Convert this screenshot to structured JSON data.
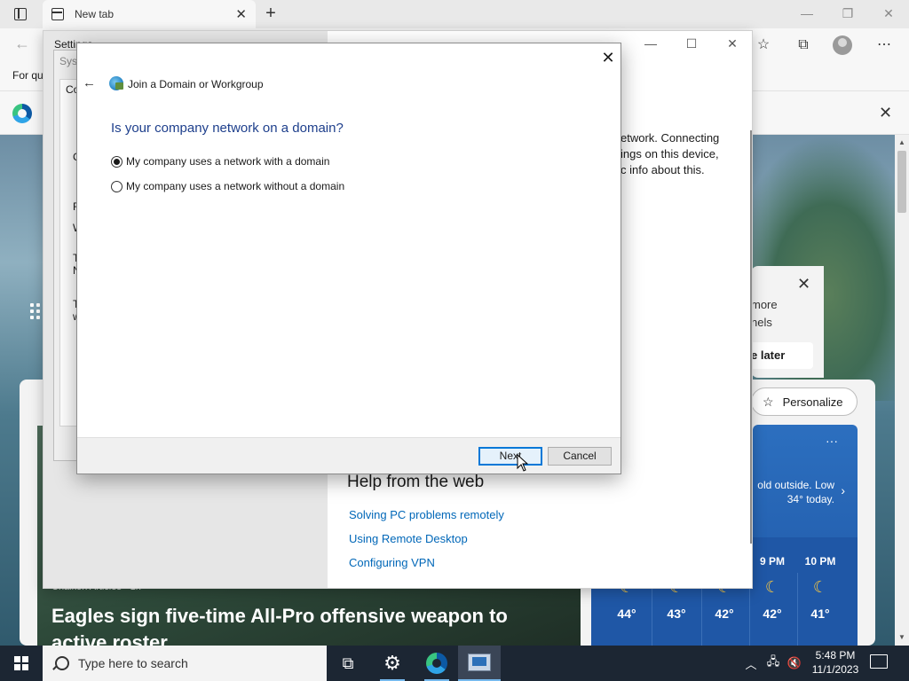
{
  "browser": {
    "tab_label": "New tab",
    "tab_close": "✕",
    "new_tab": "+",
    "favorites_bar_text": "For qu",
    "window_controls": {
      "minimize": "—",
      "restore": "❐",
      "close": "✕"
    }
  },
  "ntp": {
    "personalize_label": "Personalize",
    "popup_text_line1": "more",
    "popup_text_line2": "nels",
    "popup_button": "e later",
    "popup_close": "✕",
    "news_source": "Chalkoh Articles · 1h",
    "news_headline": "Eagles sign five-time All-Pro offensive weapon to active roster",
    "weather_more": "···",
    "weather_desc": "old outside. Low 34° today.",
    "forecast": [
      {
        "time": "",
        "temp": "44°"
      },
      {
        "time": "",
        "temp": "43°"
      },
      {
        "time": "",
        "temp": "42°"
      },
      {
        "time": "9 PM",
        "temp": "42°"
      },
      {
        "time": "10 PM",
        "temp": "41°"
      }
    ]
  },
  "settings": {
    "title": "Settings",
    "right_text": [
      "etwork. Connecting",
      "ings on this device,",
      "c info about this."
    ],
    "help_title": "Help from the web",
    "help_links": [
      "Solving PC problems remotely",
      "Using Remote Desktop",
      "Configuring VPN"
    ]
  },
  "sysprop": {
    "title": "Sys",
    "letters": [
      "Co",
      "C",
      "F",
      "W",
      "T",
      "N",
      "T",
      "w"
    ]
  },
  "dialog": {
    "title": "Join a Domain or Workgroup",
    "question": "Is your company network on a domain?",
    "options": [
      {
        "label": "My company uses a network with a domain",
        "selected": true
      },
      {
        "label": "My company uses a network without a domain",
        "selected": false
      }
    ],
    "next_label": "Next",
    "cancel_label": "Cancel",
    "close": "✕"
  },
  "taskbar": {
    "search_placeholder": "Type here to search",
    "time": "5:48 PM",
    "date": "11/1/2023"
  }
}
